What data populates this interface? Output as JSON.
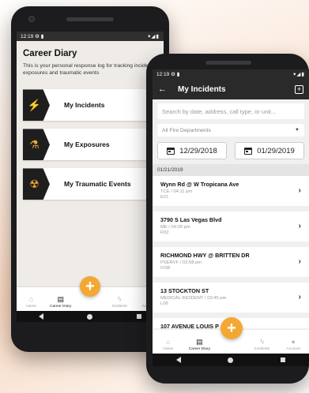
{
  "back_phone": {
    "status": {
      "time": "12:19",
      "icons_left": "⚙ ▮",
      "icons_right": "▾◢▮"
    },
    "title": "Career Diary",
    "description": "This is your personal response log for tracking incidents, exposures and traumatic events",
    "menu": [
      {
        "label": "My Incidents",
        "icon": "lightning-icon",
        "glyph": "⚡"
      },
      {
        "label": "My Exposures",
        "icon": "flask-icon",
        "glyph": "⚗"
      },
      {
        "label": "My Traumatic Events",
        "icon": "radiation-icon",
        "glyph": "☢"
      }
    ],
    "nav": [
      {
        "label": "Home",
        "glyph": "⌂"
      },
      {
        "label": "Career Diary",
        "glyph": "▤"
      },
      {
        "label": "Incidents",
        "glyph": "ϟ"
      },
      {
        "label": "Account",
        "glyph": "●"
      }
    ],
    "fab": "+"
  },
  "front_phone": {
    "status": {
      "time": "12:19",
      "icons_left": "⚙ ▮",
      "icons_right": "▾◢▮"
    },
    "title": "My Incidents",
    "back_glyph": "←",
    "add_glyph": "+",
    "search": {
      "placeholder": "Search by date, address, call type, or unit..."
    },
    "department": {
      "selected": "All Fire Departments",
      "caret": "▼"
    },
    "date_from": "12/29/2018",
    "date_to": "01/29/2019",
    "section_date": "01/21/2019",
    "incidents": [
      {
        "address": "Wynn Rd @ W Tropicana Ave",
        "meta": "TCE / 04:11 pm",
        "unit": "E21"
      },
      {
        "address": "3790 S Las Vegas Blvd",
        "meta": "ME / 04:00 pm",
        "unit": "R32"
      },
      {
        "address": "RICHMOND HWY @ BRITTEN DR",
        "meta": "PSERVF / 03:58 pm",
        "unit": "IV08"
      },
      {
        "address": "13 STOCKTON ST",
        "meta": "MEDICAL INCIDENT / 03:45 pm",
        "unit": "L06"
      },
      {
        "address": "107 AVENUE LOUIS P",
        "meta": "",
        "unit": ""
      }
    ],
    "chevron": "›",
    "nav": [
      {
        "label": "Home",
        "glyph": "⌂"
      },
      {
        "label": "Career Diary",
        "glyph": "▤"
      },
      {
        "label": "Incidents",
        "glyph": "ϟ"
      },
      {
        "label": "Account",
        "glyph": "●"
      }
    ],
    "fab": "+"
  },
  "colors": {
    "accent": "#f3a833",
    "dark": "#2a2a2a"
  }
}
